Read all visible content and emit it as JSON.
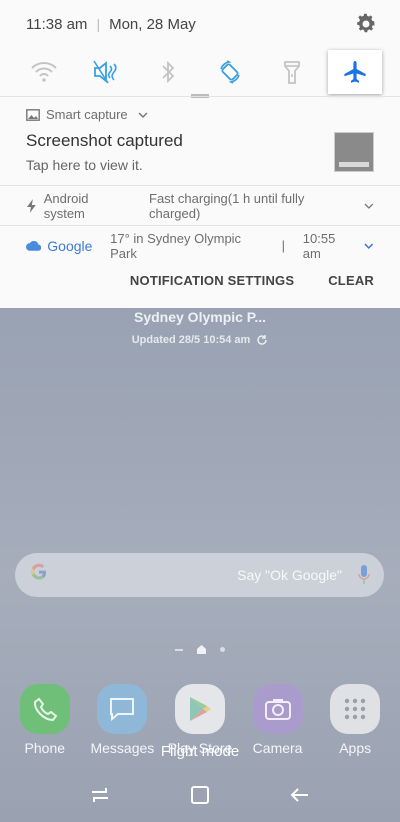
{
  "status": {
    "time": "11:38 am",
    "date": "Mon, 28 May"
  },
  "quick_settings": [
    {
      "name": "wifi-icon",
      "active": false
    },
    {
      "name": "sound-mute-icon",
      "active": false
    },
    {
      "name": "bluetooth-icon",
      "active": false
    },
    {
      "name": "auto-rotate-icon",
      "active": false
    },
    {
      "name": "flashlight-icon",
      "active": false
    },
    {
      "name": "airplane-icon",
      "active": true
    }
  ],
  "notifications": {
    "capture": {
      "app": "Smart capture",
      "title": "Screenshot captured",
      "body": "Tap here to view it."
    },
    "system": {
      "app": "Android system",
      "text": "Fast charging(1 h until fully charged)"
    },
    "google": {
      "app": "Google",
      "text": "17° in Sydney Olympic Park",
      "sep": "|",
      "time": "10:55 am"
    }
  },
  "actions": {
    "settings": "NOTIFICATION SETTINGS",
    "clear": "CLEAR"
  },
  "home": {
    "weather_location": "Sydney Olympic P...",
    "weather_updated": "Updated 28/5 10:54 am",
    "search_hint": "Say \"Ok Google\"",
    "apps": [
      {
        "label": "Phone",
        "color": "#5cc26a"
      },
      {
        "label": "Messages",
        "color": "#8ec2e8"
      },
      {
        "label": "Play Store",
        "color": "#f2f2f2"
      },
      {
        "label": "Camera",
        "color": "#b9a9d9"
      },
      {
        "label": "Apps",
        "color": "#eeeeee"
      }
    ]
  },
  "toast": "Flight mode",
  "colors": {
    "accent": "#1a73e8",
    "panel_bg": "#fafafa"
  }
}
